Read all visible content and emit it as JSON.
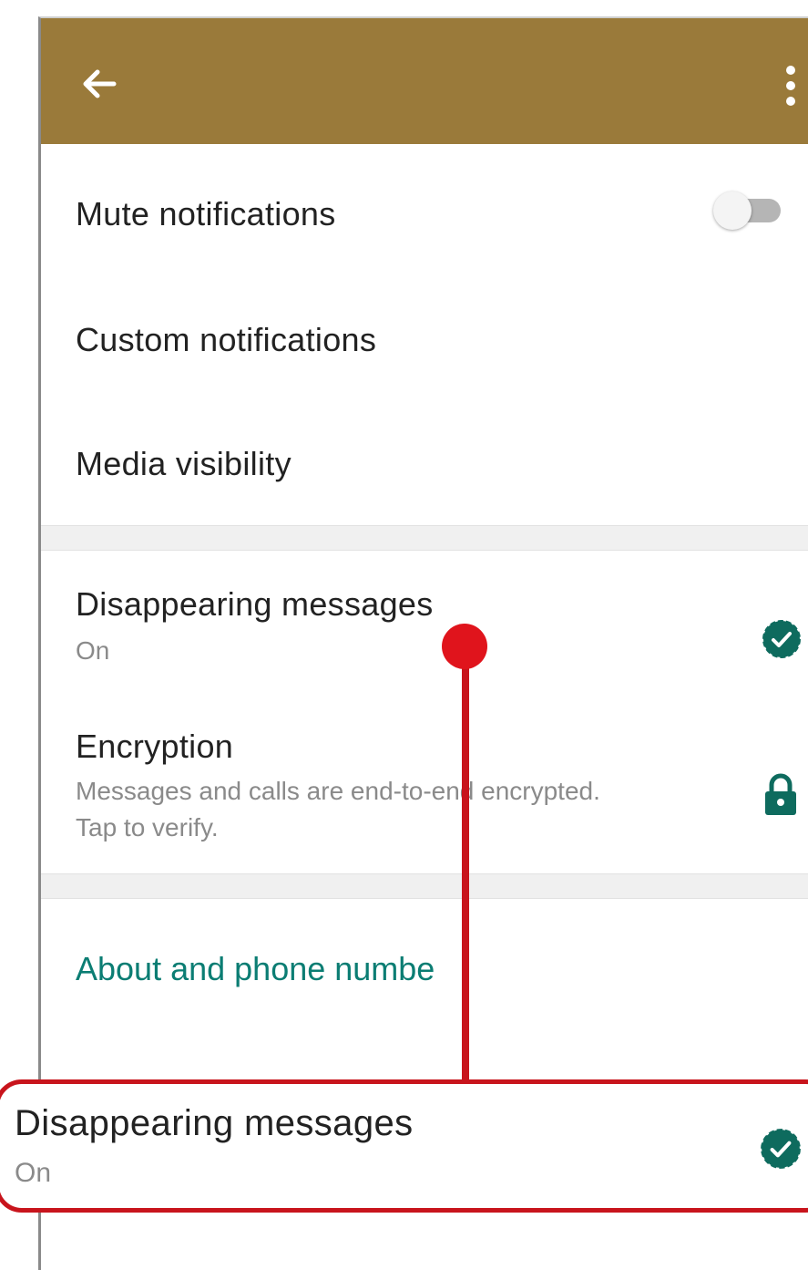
{
  "header": {
    "back_icon": "arrow-left-icon",
    "menu_icon": "more-vertical-icon",
    "bar_color": "#9a7a3a"
  },
  "settings": {
    "mute_notifications": {
      "label": "Mute notifications",
      "enabled": false
    },
    "custom_notifications": {
      "label": "Custom notifications"
    },
    "media_visibility": {
      "label": "Media visibility"
    },
    "disappearing_messages": {
      "label": "Disappearing messages",
      "status": "On",
      "icon": "disappearing-timer-icon"
    },
    "encryption": {
      "label": "Encryption",
      "description_line1": "Messages and calls are end-to-end encrypted.",
      "description_line2": "Tap to verify.",
      "icon": "lock-icon"
    },
    "about_section": {
      "label": "About and phone numbe"
    }
  },
  "callout": {
    "title": "Disappearing messages",
    "status": "On",
    "icon": "disappearing-timer-icon",
    "color": "#c8141c"
  },
  "colors": {
    "accent": "#0b7d73",
    "icon_green": "#0e6b5e"
  }
}
